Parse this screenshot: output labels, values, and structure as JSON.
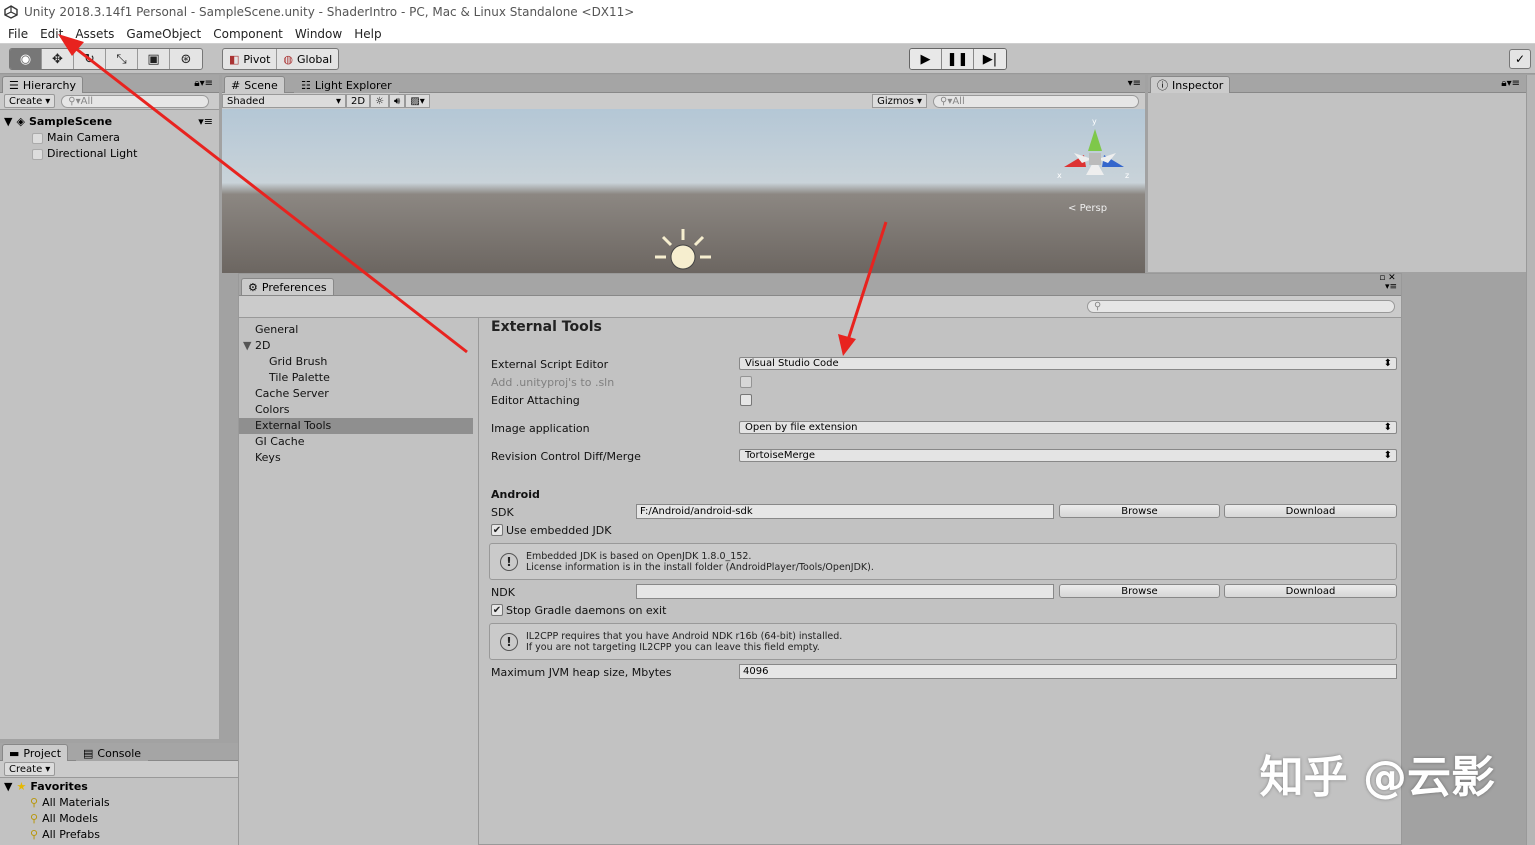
{
  "window": {
    "title": "Unity 2018.3.14f1 Personal - SampleScene.unity - ShaderIntro - PC, Mac & Linux Standalone <DX11>"
  },
  "menu": [
    "File",
    "Edit",
    "Assets",
    "GameObject",
    "Component",
    "Window",
    "Help"
  ],
  "toolbar": {
    "pivot": "Pivot",
    "global": "Global"
  },
  "hierarchy": {
    "tab": "Hierarchy",
    "create": "Create",
    "search_placeholder": "All",
    "scene": "SampleScene",
    "items": [
      "Main Camera",
      "Directional Light"
    ]
  },
  "scene": {
    "tabs": [
      "Scene",
      "Light Explorer"
    ],
    "shading": "Shaded",
    "mode2d": "2D",
    "gizmos": "Gizmos",
    "search_placeholder": "All",
    "persp": "Persp",
    "axes": {
      "y": "y",
      "x": "x",
      "z": "z"
    }
  },
  "inspector": {
    "tab": "Inspector"
  },
  "project": {
    "tabs": [
      "Project",
      "Console"
    ],
    "create": "Create",
    "favorites": "Favorites",
    "items": [
      "All Materials",
      "All Models",
      "All Prefabs"
    ]
  },
  "preferences": {
    "tab": "Preferences",
    "nav": [
      {
        "label": "General",
        "indent": 0
      },
      {
        "label": "2D",
        "indent": 0,
        "expand": "▼"
      },
      {
        "label": "Grid Brush",
        "indent": 1
      },
      {
        "label": "Tile Palette",
        "indent": 1
      },
      {
        "label": "Cache Server",
        "indent": 0
      },
      {
        "label": "Colors",
        "indent": 0
      },
      {
        "label": "External Tools",
        "indent": 0,
        "selected": true
      },
      {
        "label": "GI Cache",
        "indent": 0
      },
      {
        "label": "Keys",
        "indent": 0
      }
    ],
    "section_title": "External Tools",
    "script_editor_label": "External Script Editor",
    "script_editor_value": "Visual Studio Code",
    "add_unityproj_label": "Add .unityproj's to .sln",
    "editor_attaching_label": "Editor Attaching",
    "image_app_label": "Image application",
    "image_app_value": "Open by file extension",
    "revision_label": "Revision Control Diff/Merge",
    "revision_value": "TortoiseMerge",
    "android_header": "Android",
    "sdk_label": "SDK",
    "sdk_value": "F:/Android/android-sdk",
    "browse": "Browse",
    "download": "Download",
    "use_jdk_label": "Use embedded JDK",
    "jdk_info_line1": "Embedded JDK is based on OpenJDK 1.8.0_152.",
    "jdk_info_line2": "License information is in the install folder (AndroidPlayer/Tools/OpenJDK).",
    "ndk_label": "NDK",
    "ndk_value": "",
    "gradle_label": "Stop Gradle daemons on exit",
    "il2cpp_line1": "IL2CPP requires that you have Android NDK r16b (64-bit) installed.",
    "il2cpp_line2": "If you are not targeting IL2CPP you can leave this field empty.",
    "jvm_label": "Maximum JVM heap size, Mbytes",
    "jvm_value": "4096"
  },
  "watermark": "知乎 @云影",
  "colors": {
    "annotation_arrow": "#e8231f",
    "selected_row": "#8f8f8f"
  }
}
